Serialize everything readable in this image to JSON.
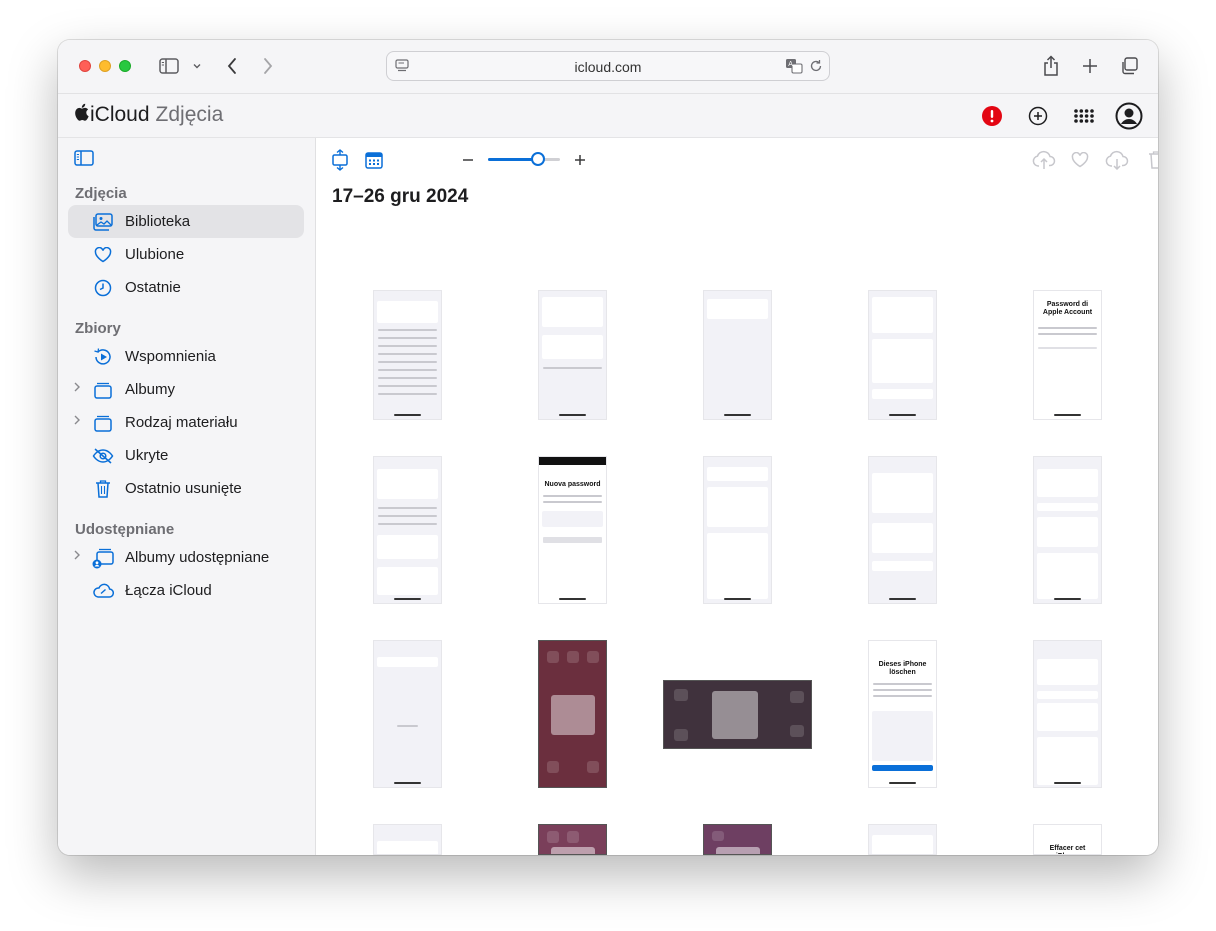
{
  "browser": {
    "url": "icloud.com"
  },
  "app": {
    "apple_logo": "",
    "brand": "iCloud",
    "product": "Zdjęcia"
  },
  "sidebar": {
    "sections": [
      {
        "title": "Zdjęcia",
        "items": [
          {
            "label": "Biblioteka",
            "icon": "library-icon",
            "selected": true
          },
          {
            "label": "Ulubione",
            "icon": "heart-icon"
          },
          {
            "label": "Ostatnie",
            "icon": "clock-icon"
          }
        ]
      },
      {
        "title": "Zbiory",
        "items": [
          {
            "label": "Wspomnienia",
            "icon": "memories-icon"
          },
          {
            "label": "Albumy",
            "icon": "albums-icon",
            "expandable": true
          },
          {
            "label": "Rodzaj materiału",
            "icon": "media-types-icon",
            "expandable": true
          },
          {
            "label": "Ukryte",
            "icon": "eye-slash-icon"
          },
          {
            "label": "Ostatnio usunięte",
            "icon": "trash-icon"
          }
        ]
      },
      {
        "title": "Udostępniane",
        "items": [
          {
            "label": "Albumy udostępniane",
            "icon": "shared-albums-icon",
            "expandable": true
          },
          {
            "label": "Łącza iCloud",
            "icon": "icloud-link-icon"
          }
        ]
      }
    ]
  },
  "content": {
    "date_range": "17–26 gru 2024",
    "zoom_fraction": 0.7,
    "thumbnails": {
      "row1": [
        {
          "label": ""
        },
        {
          "label": ""
        },
        {
          "label": ""
        },
        {
          "label": ""
        },
        {
          "label": "Password di Apple Account"
        }
      ],
      "row2": [
        {
          "label": ""
        },
        {
          "label": "Nuova password"
        },
        {
          "label": ""
        },
        {
          "label": ""
        },
        {
          "label": ""
        }
      ],
      "row3": [
        {
          "label": ""
        },
        {
          "label": ""
        },
        {
          "label": ""
        },
        {
          "label": "Dieses iPhone löschen"
        },
        {
          "label": ""
        }
      ],
      "row4": [
        {
          "label": ""
        },
        {
          "label": ""
        },
        {
          "label": ""
        },
        {
          "label": ""
        },
        {
          "label": "Effacer cet iPhone"
        }
      ]
    }
  },
  "colors": {
    "accent": "#0a6fd8",
    "alert": "#e30613"
  }
}
